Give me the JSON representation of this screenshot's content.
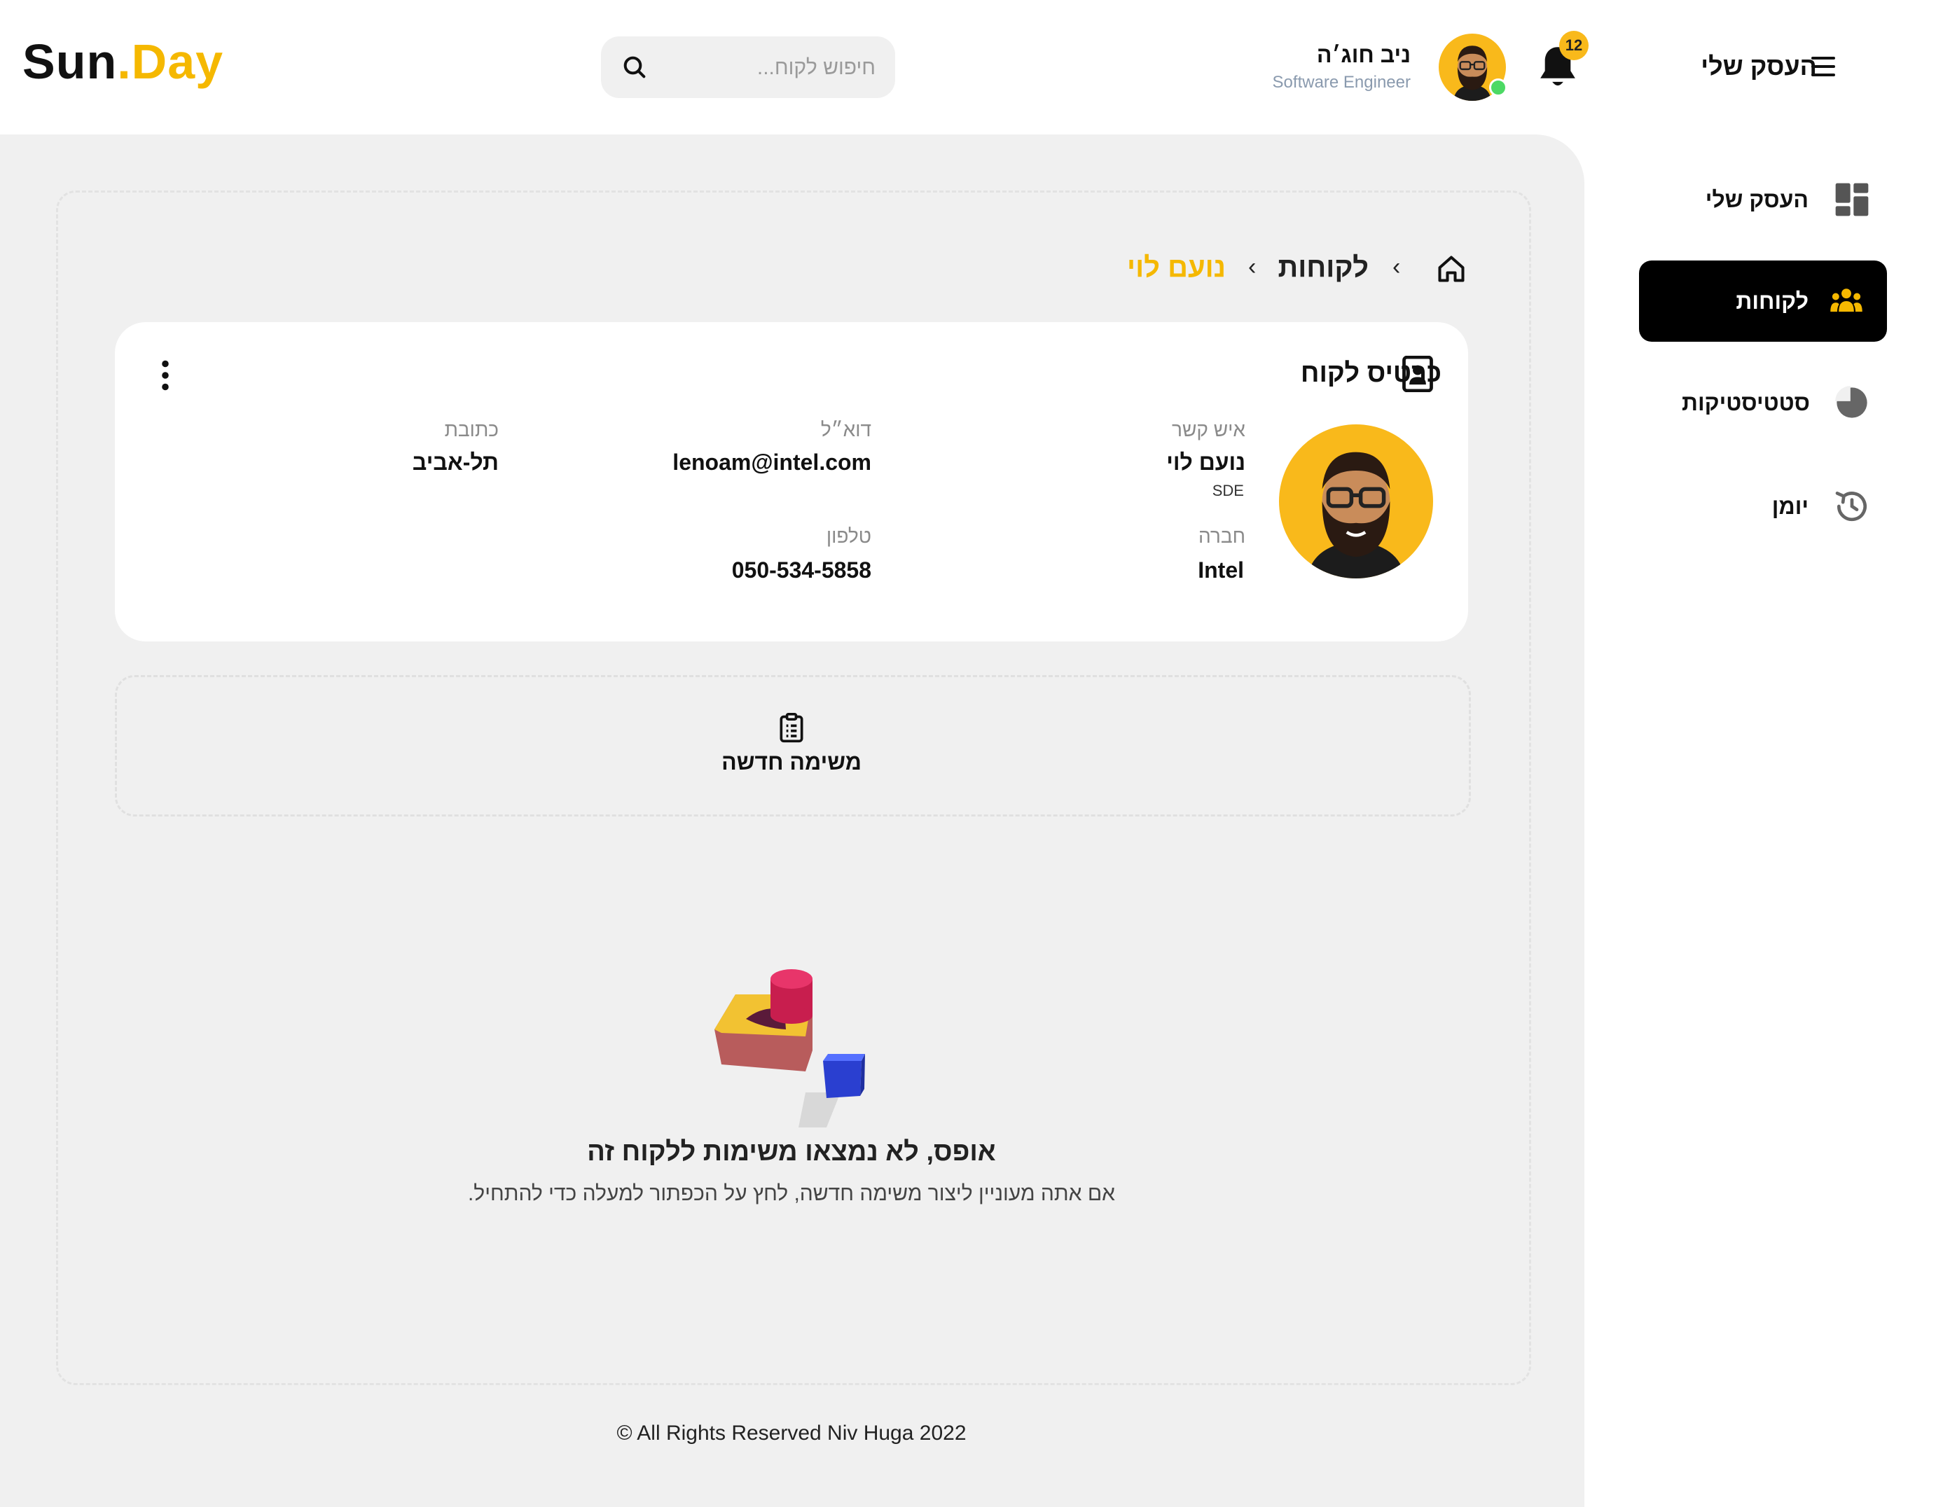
{
  "app": {
    "logo_part1": "Sun",
    "logo_dot": ".",
    "logo_part2": "Day"
  },
  "header": {
    "search_placeholder": "חיפוש לקוח...",
    "user_name": "ניב חוג׳ה",
    "user_role": "Software Engineer",
    "notifications_count": "12",
    "menu_title": "העסק שלי"
  },
  "sidebar": {
    "items": [
      {
        "label": "העסק שלי",
        "icon": "dashboard-icon",
        "active": false
      },
      {
        "label": "לקוחות",
        "icon": "users-icon",
        "active": true
      },
      {
        "label": "סטטיסטיקות",
        "icon": "pie-chart-icon",
        "active": false
      },
      {
        "label": "יומן",
        "icon": "history-icon",
        "active": false
      }
    ]
  },
  "breadcrumb": {
    "customers": "לקוחות",
    "current": "נועם לוי"
  },
  "customer_card": {
    "title": "כרטיס לקוח",
    "contact_label": "איש קשר",
    "contact_name": "נועם לוי",
    "contact_title": "SDE",
    "company_label": "חברה",
    "company_value": "Intel",
    "email_label": "דוא״ל",
    "email_value": "lenoam@intel.com",
    "phone_label": "טלפון",
    "phone_value": "050-534-5858",
    "address_label": "כתובת",
    "address_value": "תל-אביב"
  },
  "tasks": {
    "new_task_label": "משימה חדשה",
    "empty_title": "אופס, לא נמצאו משימות ללקוח זה",
    "empty_subtitle": "אם אתה מעוניין ליצור משימה חדשה, לחץ על הכפתור למעלה כדי להתחיל."
  },
  "footer": {
    "copyright": "© All Rights Reserved Niv Huga 2022"
  },
  "colors": {
    "accent": "#F5B800",
    "avatar_bg": "#F9B91B",
    "panel_bg": "#f0f0f0",
    "active_nav_bg": "#000000",
    "online": "#4cd964"
  }
}
